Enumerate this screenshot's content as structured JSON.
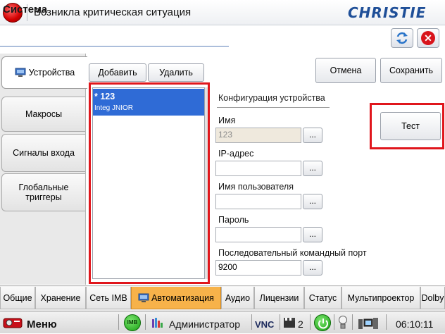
{
  "titlebar": {
    "title": "Возникла критическая ситуация",
    "brand": "CHRISTIE"
  },
  "header": {
    "page_title": "Система"
  },
  "side_tabs": [
    {
      "label": "Устройства",
      "active": true
    },
    {
      "label": "Макросы"
    },
    {
      "label": "Сигналы входа"
    },
    {
      "label_line1": "Глобальные",
      "label_line2": "триггеры"
    }
  ],
  "list_toolbar": {
    "add_label": "Добавить",
    "delete_label": "Удалить"
  },
  "actions": {
    "cancel_label": "Отмена",
    "save_label": "Сохранить",
    "test_label": "Тест"
  },
  "devices": [
    {
      "name": "* 123",
      "type": "Integ JNIOR"
    }
  ],
  "config": {
    "title": "Конфигурация устройства",
    "name_label": "Имя",
    "name_value": "123",
    "ip_label": "IP-адрес",
    "ip_value": "",
    "user_label": "Имя пользователя",
    "user_value": "",
    "password_label": "Пароль",
    "password_value": "",
    "port_label": "Последовательный командный порт",
    "port_value": "9200",
    "dots": "..."
  },
  "bottom_tabs": [
    "Общие",
    "Хранение",
    "Сеть IMB",
    "Автоматизация",
    "Аудио",
    "Лицензии",
    "Статус",
    "Мультипроектор",
    "Dolby"
  ],
  "statusbar": {
    "menu_label": "Меню",
    "imb_badge": "IMB",
    "user": "Администратор",
    "vnc": "VNC",
    "count": "2",
    "time": "06:10:11"
  },
  "colors": {
    "accent_blue": "#2f6bd6",
    "highlight_red": "#e0161c",
    "active_tab": "#f7b24a"
  }
}
